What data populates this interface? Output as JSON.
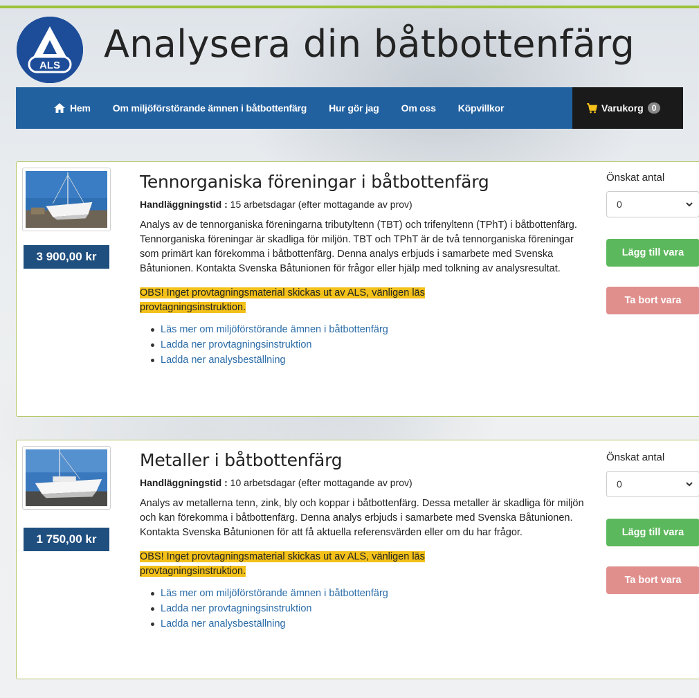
{
  "site": {
    "title": "Analysera din båtbottenfärg",
    "logo_text": "ALS",
    "colors": {
      "nav": "#2261a0",
      "accent_line": "#9dc23b",
      "price_bg": "#1f4f7f",
      "highlight": "#f3c11a"
    }
  },
  "nav": {
    "home": {
      "label": "Hem",
      "icon": "home-icon"
    },
    "items": [
      {
        "label": "Om miljöförstörande ämnen i båtbottenfärg"
      },
      {
        "label": "Hur gör jag"
      },
      {
        "label": "Om oss"
      },
      {
        "label": "Köpvillkor"
      }
    ],
    "cart": {
      "label": "Varukorg",
      "count": "0",
      "icon": "cart-icon"
    }
  },
  "products": [
    {
      "title": "Tennorganiska föreningar i båtbottenfärg",
      "price": "3 900,00 kr",
      "handling_label": "Handläggningstid :",
      "handling_value": " 15 arbetsdagar (efter mottagande av prov)",
      "description": "Analys av de tennorganiska föreningarna tributyltenn (TBT) och trifenyltenn (TPhT) i båtbottenfärg. Tennorganiska föreningar är skadliga för miljön. TBT och TPhT är de två tennorganiska föreningar som primärt kan förekomma i båtbottenfärg. Denna analys erbjuds i samarbete med Svenska Båtunionen. Kontakta Svenska Båtunionen för frågor eller hjälp med tolkning av analysresultat.",
      "obs": "OBS! Inget provtagningsmaterial skickas ut av ALS, vänligen läs provtagningsinstruktion.",
      "links": [
        "Läs mer om miljöförstörande ämnen i båtbottenfärg",
        "Ladda ner provtagningsinstruktion",
        "Ladda ner analysbeställning"
      ],
      "qty_label": "Önskat antal",
      "qty_value": "0",
      "add_label": "Lägg till vara",
      "remove_label": "Ta bort vara"
    },
    {
      "title": "Metaller i båtbottenfärg",
      "price": "1 750,00 kr",
      "handling_label": "Handläggningstid :",
      "handling_value": " 10 arbetsdagar (efter mottagande av prov)",
      "description": "Analys av metallerna tenn, zink, bly och koppar i båtbottenfärg. Dessa metaller är skadliga för miljön och kan förekomma i båtbottenfärg. Denna analys erbjuds i samarbete med Svenska Båtunionen. Kontakta Svenska Båtunionen för att få aktuella referensvärden eller om du har frågor.",
      "obs": "OBS! Inget provtagningsmaterial skickas ut av ALS, vänligen läs provtagningsinstruktion.",
      "links": [
        "Läs mer om miljöförstörande ämnen i båtbottenfärg",
        "Ladda ner provtagningsinstruktion",
        "Ladda ner analysbeställning"
      ],
      "qty_label": "Önskat antal",
      "qty_value": "0",
      "add_label": "Lägg till vara",
      "remove_label": "Ta bort vara"
    }
  ]
}
